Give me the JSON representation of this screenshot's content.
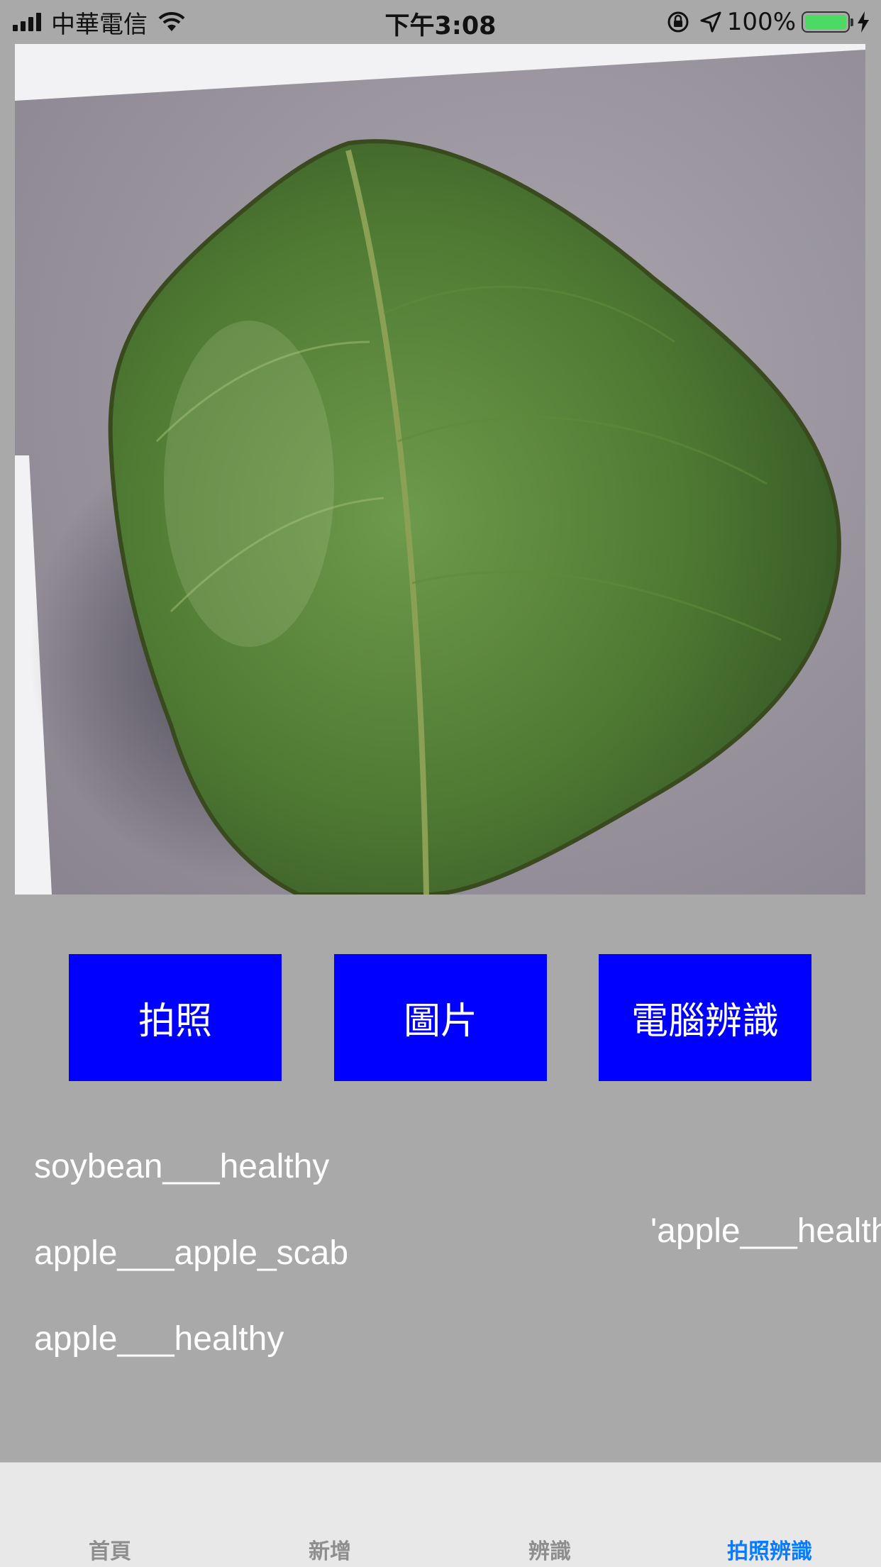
{
  "status_bar": {
    "carrier": "中華電信",
    "time": "下午3:08",
    "battery_percent": "100%",
    "battery_level": 1.0,
    "battery_color": "#4cd964"
  },
  "photo": {
    "icon": "leaf-photo"
  },
  "buttons": {
    "take_photo": "拍照",
    "gallery": "圖片",
    "recognize": "電腦辨識",
    "color": "#0000ff"
  },
  "results": {
    "items": [
      "soybean___healthy",
      "apple___apple_scab",
      "apple___healthy"
    ],
    "top_prediction": "'apple___healthy"
  },
  "tab_bar": {
    "tabs": [
      {
        "label": "首頁"
      },
      {
        "label": "新增"
      },
      {
        "label": "辨識"
      },
      {
        "label": "拍照辨識"
      }
    ],
    "active_color": "#0a7bff"
  }
}
